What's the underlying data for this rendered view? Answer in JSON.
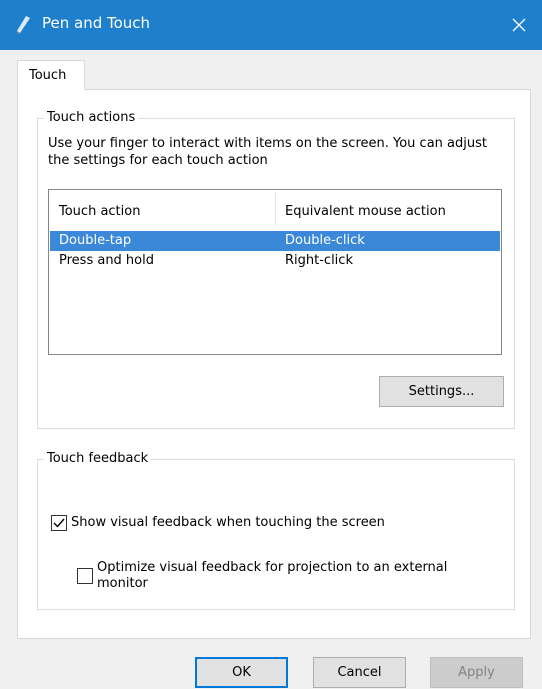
{
  "window": {
    "title": "Pen and Touch",
    "close_label": "✕"
  },
  "tabs": [
    {
      "label": "Touch",
      "selected": true
    }
  ],
  "touch_actions": {
    "legend": "Touch actions",
    "description": "Use your finger to interact with items on the screen. You can adjust the settings for each touch action",
    "columns": [
      "Touch action",
      "Equivalent mouse action"
    ],
    "rows": [
      {
        "action": "Double-tap",
        "mouse": "Double-click",
        "selected": true
      },
      {
        "action": "Press and hold",
        "mouse": "Right-click",
        "selected": false
      }
    ],
    "settings_label": "Settings..."
  },
  "touch_feedback": {
    "legend": "Touch feedback",
    "show_visual_feedback": {
      "label": "Show visual feedback when touching the screen",
      "checked": true
    },
    "optimize_projection": {
      "label": "Optimize visual feedback for projection to an external monitor",
      "checked": false
    }
  },
  "buttons": {
    "ok": "OK",
    "cancel": "Cancel",
    "apply": "Apply"
  },
  "colors": {
    "titlebar": "#1e80cc",
    "selection": "#3b88d8",
    "default_button_border": "#0078d7"
  }
}
